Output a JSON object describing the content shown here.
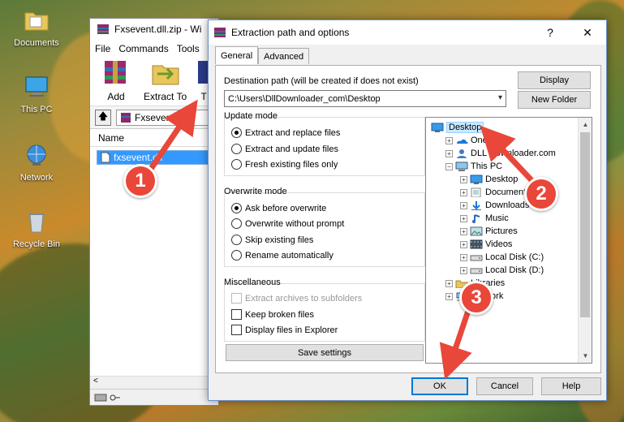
{
  "desktop": {
    "icons": [
      {
        "label": "Documents",
        "icon": "folder-documents-icon"
      },
      {
        "label": "This PC",
        "icon": "computer-icon"
      },
      {
        "label": "Network",
        "icon": "network-icon"
      },
      {
        "label": "Recycle Bin",
        "icon": "recycle-bin-icon"
      }
    ]
  },
  "winrar": {
    "title": "Fxsevent.dll.zip - Wi",
    "menu": [
      "File",
      "Commands",
      "Tools"
    ],
    "toolbar": {
      "add": "Add",
      "extract_to": "Extract To",
      "test_partial": "T"
    },
    "address": "Fxsevent.dl",
    "column_name": "Name",
    "file_name": "fxsevent.dll"
  },
  "dialog": {
    "title": "Extraction path and options",
    "help_glyph": "?",
    "close_glyph": "✕",
    "tabs": [
      "General",
      "Advanced"
    ],
    "destination_label": "Destination path (will be created if does not exist)",
    "destination_value": "C:\\Users\\DllDownloader_com\\Desktop",
    "display_button": "Display",
    "new_folder_button": "New Folder",
    "update_mode": {
      "title": "Update mode",
      "options": [
        "Extract and replace files",
        "Extract and update files",
        "Fresh existing files only"
      ],
      "selected": 0
    },
    "overwrite_mode": {
      "title": "Overwrite mode",
      "options": [
        "Ask before overwrite",
        "Overwrite without prompt",
        "Skip existing files",
        "Rename automatically"
      ],
      "selected": 0
    },
    "miscellaneous": {
      "title": "Miscellaneous",
      "options": [
        "Extract archives to subfolders",
        "Keep broken files",
        "Display files in Explorer"
      ]
    },
    "save_settings": "Save settings",
    "tree": [
      {
        "label": "Desktop",
        "level": 0,
        "expander": "",
        "icon": "desktop-icon",
        "selected": true
      },
      {
        "label": "OneDrive",
        "level": 1,
        "expander": "+",
        "icon": "onedrive-icon"
      },
      {
        "label": "DLL Downloader.com",
        "level": 1,
        "expander": "+",
        "icon": "user-icon"
      },
      {
        "label": "This PC",
        "level": 1,
        "expander": "−",
        "icon": "computer-icon"
      },
      {
        "label": "Desktop",
        "level": 2,
        "expander": "+",
        "icon": "desktop-icon"
      },
      {
        "label": "Documents",
        "level": 2,
        "expander": "+",
        "icon": "documents-icon"
      },
      {
        "label": "Downloads",
        "level": 2,
        "expander": "+",
        "icon": "downloads-icon"
      },
      {
        "label": "Music",
        "level": 2,
        "expander": "+",
        "icon": "music-icon"
      },
      {
        "label": "Pictures",
        "level": 2,
        "expander": "+",
        "icon": "pictures-icon"
      },
      {
        "label": "Videos",
        "level": 2,
        "expander": "+",
        "icon": "videos-icon"
      },
      {
        "label": "Local Disk (C:)",
        "level": 2,
        "expander": "+",
        "icon": "drive-icon"
      },
      {
        "label": "Local Disk (D:)",
        "level": 2,
        "expander": "+",
        "icon": "drive-icon"
      },
      {
        "label": "Libraries",
        "level": 1,
        "expander": "+",
        "icon": "libraries-icon"
      },
      {
        "label": "Network",
        "level": 1,
        "expander": "+",
        "icon": "network-icon"
      }
    ],
    "ok": "OK",
    "cancel": "Cancel",
    "help": "Help"
  },
  "annotations": [
    "1",
    "2",
    "3"
  ],
  "colors": {
    "badge": "#e8473a",
    "selection": "#cce8ff",
    "accent": "#0078d7"
  }
}
